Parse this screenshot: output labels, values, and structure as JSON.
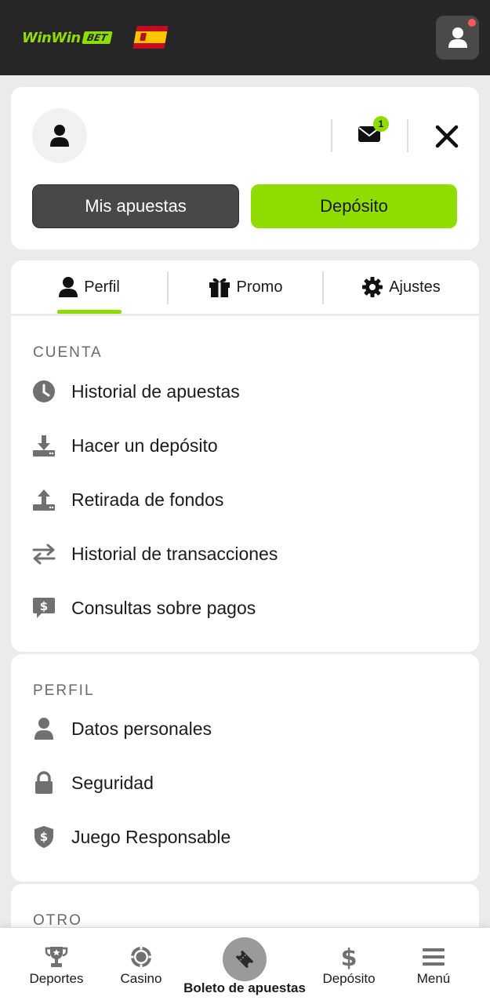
{
  "header": {
    "logo_text": "WinWin",
    "logo_badge": "BET",
    "language_flag": "spain-flag-icon",
    "user_icon": "user-icon",
    "notification_dot_color": "#ff5a5a"
  },
  "account": {
    "avatar_icon": "user-icon",
    "messages_badge": "1",
    "my_bets_label": "Mis apuestas",
    "deposit_label": "Depósito"
  },
  "tabs": [
    {
      "label": "Perfil",
      "icon": "user-icon",
      "active": true
    },
    {
      "label": "Promo",
      "icon": "gift-icon",
      "active": false
    },
    {
      "label": "Ajustes",
      "icon": "gear-icon",
      "active": false
    }
  ],
  "sections": {
    "cuenta": {
      "title": "CUENTA",
      "items": [
        {
          "label": "Historial de apuestas",
          "icon": "clock-icon"
        },
        {
          "label": "Hacer un depósito",
          "icon": "download-icon"
        },
        {
          "label": "Retirada de fondos",
          "icon": "upload-icon"
        },
        {
          "label": "Historial de transacciones",
          "icon": "transfer-arrows-icon"
        },
        {
          "label": "Consultas sobre pagos",
          "icon": "payment-chat-icon"
        }
      ]
    },
    "perfil": {
      "title": "PERFIL",
      "items": [
        {
          "label": "Datos personales",
          "icon": "user-icon"
        },
        {
          "label": "Seguridad",
          "icon": "lock-icon"
        },
        {
          "label": "Juego Responsable",
          "icon": "shield-dollar-icon"
        }
      ]
    },
    "otro": {
      "title": "OTRO"
    }
  },
  "bottom_nav": [
    {
      "label": "Deportes",
      "icon": "trophy-icon"
    },
    {
      "label": "Casino",
      "icon": "casino-chip-icon"
    },
    {
      "label": "Boleto de apuestas",
      "icon": "ticket-icon"
    },
    {
      "label": "Depósito",
      "icon": "dollar-icon"
    },
    {
      "label": "Menú",
      "icon": "menu-icon"
    }
  ],
  "colors": {
    "accent": "#8fdc00",
    "topbar": "#262626",
    "dark_button": "#484848",
    "background": "#ebebeb"
  }
}
